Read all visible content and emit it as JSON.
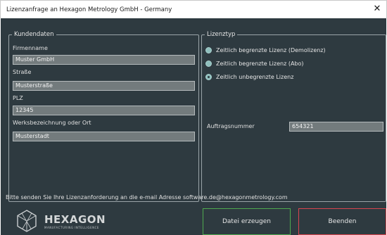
{
  "window": {
    "title": "Lizenzanfrage an Hexagon Metrology GmbH - Germany",
    "close_glyph": "✕"
  },
  "kundendaten": {
    "legend": "Kundendaten",
    "fields": [
      {
        "label": "Firmenname",
        "value": "Muster GmbH"
      },
      {
        "label": "Straße",
        "value": "Musterstraße"
      },
      {
        "label": "PLZ",
        "value": "12345"
      },
      {
        "label": "Werksbezeichnung oder Ort",
        "value": "Musterstadt"
      }
    ]
  },
  "lizenztyp": {
    "legend": "Lizenztyp",
    "options": [
      {
        "label": "Zeitlich begrenzte Lizenz (Demolizenz)",
        "checked": false
      },
      {
        "label": "Zeitlich begrenzte Lizenz (Abo)",
        "checked": false
      },
      {
        "label": "Zeitlich unbegrenzte Lizenz",
        "checked": true
      }
    ],
    "order_label": "Auftragsnummer",
    "order_value": "654321"
  },
  "footer": {
    "note": "Bitte senden Sie Ihre Lizenzanforderung an die e-mail Adresse software.de@hexagonmetrology.com"
  },
  "logo": {
    "word": "HEXAGON",
    "tagline": "MANUFACTURING INTELLIGENCE"
  },
  "buttons": {
    "create": "Datei erzeugen",
    "exit": "Beenden"
  },
  "colors": {
    "background": "#2e3a40",
    "field": "#737b7d",
    "create_border": "#4ea94e",
    "exit_border": "#d9454f",
    "radio": "#8fbfbd"
  }
}
